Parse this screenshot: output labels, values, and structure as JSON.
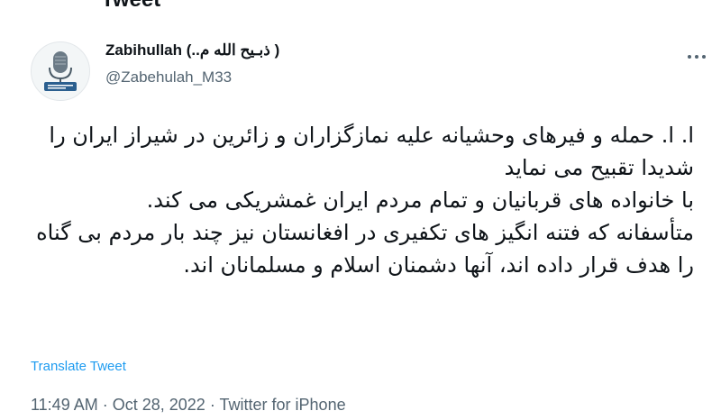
{
  "header": {
    "title": "Tweet"
  },
  "author": {
    "name": "Zabihullah (..ذبـیح الله م )",
    "handle": "@Zabehulah_M33",
    "avatar": "microphone-avatar-icon"
  },
  "menu": {
    "icon": "more-horizontal-icon"
  },
  "tweet": {
    "paragraphs": [
      "ا. ا. حمله و فیرهای وحشیانه علیه نمازگزاران و زائرین در شیراز ایران را شدیدا تقبیح می نماید",
      "با خانواده های قربانیان و تمام مردم ایران غمشریکی می کند.",
      "متأسفانه که فتنه انگیز های تکفیری در افغانستان نیز چند بار مردم بی گناه را هدف قرار داده اند، آنها دشمنان اسلام و مسلمانان اند."
    ],
    "translate_label": "Translate Tweet",
    "time": "11:49 AM",
    "separator": "·",
    "date": "Oct 28, 2022",
    "source": "Twitter for iPhone"
  },
  "colors": {
    "link": "#1d9bf0",
    "secondary": "#536471",
    "primary_text": "#0f1419"
  }
}
